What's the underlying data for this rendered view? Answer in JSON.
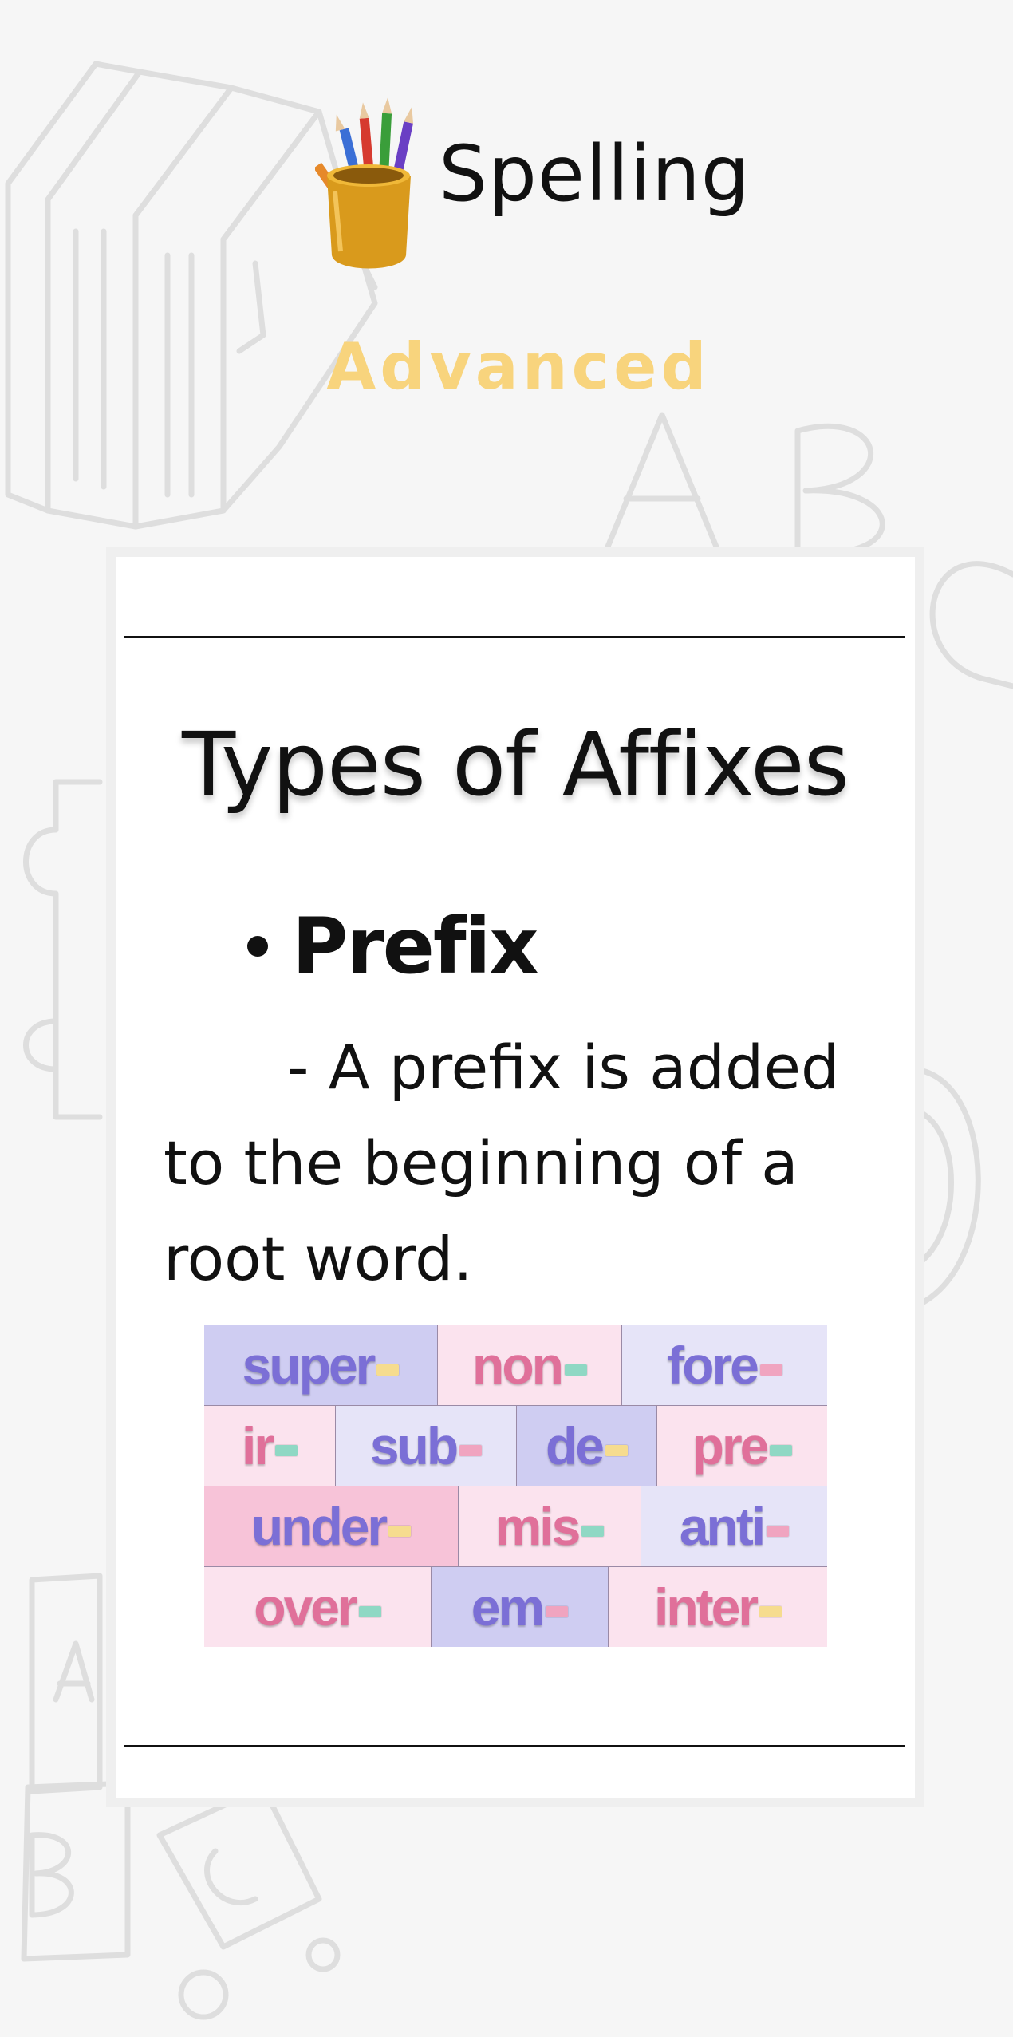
{
  "header": {
    "app_title": "Spelling",
    "level": "Advanced"
  },
  "card": {
    "title": "Types of Affixes",
    "bullet_label": "Prefix",
    "definition": "- A prefix is added to the beginning of a root word."
  },
  "colors": {
    "background": "#f6f6f6",
    "level_yellow": "#f8d47d",
    "purple_text": "#7b6fd6",
    "pink_text": "#e0709a",
    "tile_lavender": "#cfcdf2",
    "tile_light_lavender": "#e6e4f8",
    "tile_pink": "#f7c3d8",
    "tile_light_pink": "#fbe3ee",
    "dash_yellow": "#f6dc8f",
    "dash_teal": "#8fd8c4",
    "dash_pink": "#f0a4c0"
  },
  "prefix_grid": {
    "rows": [
      [
        {
          "text": "super-",
          "text_color": "purple",
          "bg": "lavender",
          "dash": "yellow"
        },
        {
          "text": "non-",
          "text_color": "pink",
          "bg": "light_pink",
          "dash": "teal"
        },
        {
          "text": "fore-",
          "text_color": "purple",
          "bg": "light_lavender",
          "dash": "pink"
        }
      ],
      [
        {
          "text": "ir-",
          "text_color": "pink",
          "bg": "light_pink",
          "dash": "teal"
        },
        {
          "text": "sub-",
          "text_color": "purple",
          "bg": "light_lavender",
          "dash": "pink"
        },
        {
          "text": "de-",
          "text_color": "purple",
          "bg": "lavender",
          "dash": "yellow"
        },
        {
          "text": "pre-",
          "text_color": "pink",
          "bg": "light_pink",
          "dash": "teal"
        }
      ],
      [
        {
          "text": "under-",
          "text_color": "purple",
          "bg": "pink",
          "dash": "yellow"
        },
        {
          "text": "mis-",
          "text_color": "pink",
          "bg": "light_pink",
          "dash": "teal"
        },
        {
          "text": "anti-",
          "text_color": "purple",
          "bg": "light_lavender",
          "dash": "pink"
        }
      ],
      [
        {
          "text": "over-",
          "text_color": "pink",
          "bg": "light_pink",
          "dash": "teal"
        },
        {
          "text": "em-",
          "text_color": "purple",
          "bg": "lavender",
          "dash": "pink"
        },
        {
          "text": "inter-",
          "text_color": "pink",
          "bg": "light_pink",
          "dash": "yellow"
        }
      ]
    ]
  },
  "icons": {
    "header_icon": "pencil-cup-icon",
    "background": "school-doodles"
  }
}
